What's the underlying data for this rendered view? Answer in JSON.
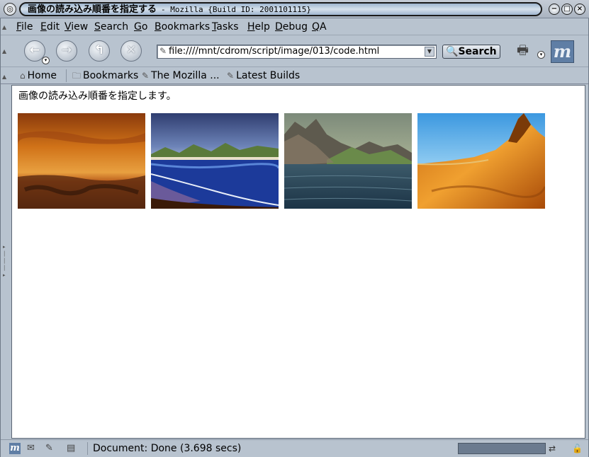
{
  "window": {
    "title": "画像の読み込み順番を指定する",
    "subtitle": "- Mozilla {Build ID: 2001101115}"
  },
  "menubar": {
    "items": [
      {
        "mnemonic": "F",
        "rest": "ile"
      },
      {
        "mnemonic": "E",
        "rest": "dit"
      },
      {
        "mnemonic": "V",
        "rest": "iew"
      },
      {
        "mnemonic": "S",
        "rest": "earch"
      },
      {
        "mnemonic": "G",
        "rest": "o"
      },
      {
        "mnemonic": "B",
        "rest": "ookmarks"
      },
      {
        "mnemonic": "T",
        "rest": "asks"
      },
      {
        "mnemonic": "H",
        "rest": "elp"
      },
      {
        "mnemonic": "D",
        "rest": "ebug"
      },
      {
        "mnemonic": "Q",
        "rest": "A"
      }
    ]
  },
  "navbar": {
    "url": "file:////mnt/cdrom/script/image/013/code.html",
    "search_label": "Search"
  },
  "personal_toolbar": {
    "home_label": "Home",
    "bookmarks_label": "Bookmarks",
    "mozilla_label": "The Mozilla ...",
    "builds_label": "Latest Builds"
  },
  "page": {
    "text": "画像の読み込み順番を指定します。"
  },
  "status": {
    "text": "Document: Done (3.698 secs)"
  },
  "colors": {
    "chrome": "#b8c3cf",
    "progress": "#6b7b8f",
    "throbber": "#5f7ea5"
  },
  "icons": {
    "back": "back-arrow-icon",
    "forward": "forward-arrow-icon",
    "reload": "reload-icon",
    "stop": "stop-icon",
    "home": "home-icon",
    "bookmark_folder": "folder-icon",
    "bookmark_link": "bookmark-link-icon",
    "print": "printer-icon",
    "logo": "mozilla-logo-icon"
  }
}
